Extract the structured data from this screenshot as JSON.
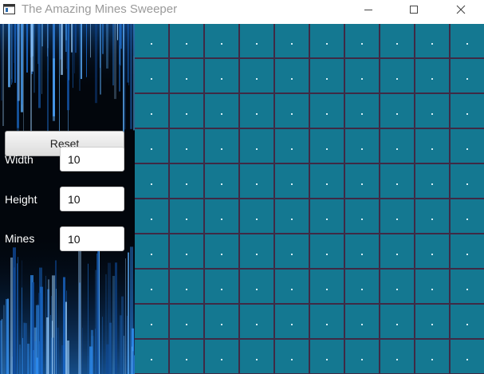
{
  "window": {
    "title": "The Amazing Mines Sweeper",
    "controls": [
      "minimize-icon",
      "maximize-icon",
      "close-icon"
    ]
  },
  "sidebar": {
    "reset_label": "Reset",
    "fields": [
      {
        "label": "Width",
        "value": "10"
      },
      {
        "label": "Height",
        "value": "10"
      },
      {
        "label": "Mines",
        "value": "10"
      }
    ]
  },
  "board": {
    "columns": 10,
    "rows": 10,
    "cell_state": "unrevealed",
    "cell_color": "#147891",
    "grid_line_color": "#3f2a45"
  }
}
